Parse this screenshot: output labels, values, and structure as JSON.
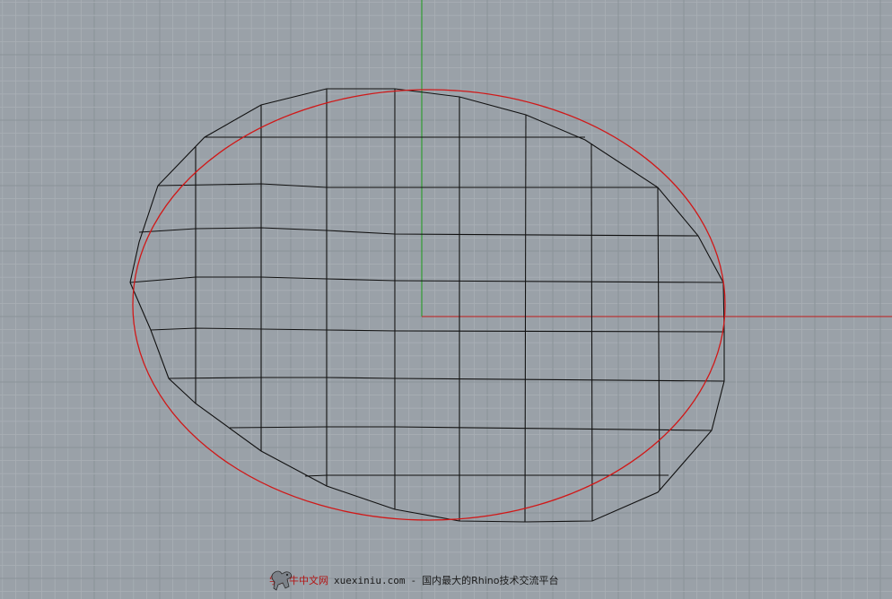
{
  "viewport": {
    "background_color": "#9aa1a8",
    "grid_minor_color": "#a9afb5",
    "grid_major_color": "#8b9299",
    "x_axis_color": "#c01a1a",
    "y_axis_color": "#1a9a1a",
    "mesh_color": "#111111",
    "curve_color": "#d01818"
  },
  "watermark": {
    "logo_icon": "ox-logo-icon",
    "brand": "学犀牛中文网",
    "site": "xuexiniu.com",
    "separator": "-",
    "slogan": "国内最大的Rhino技术交流平台"
  }
}
